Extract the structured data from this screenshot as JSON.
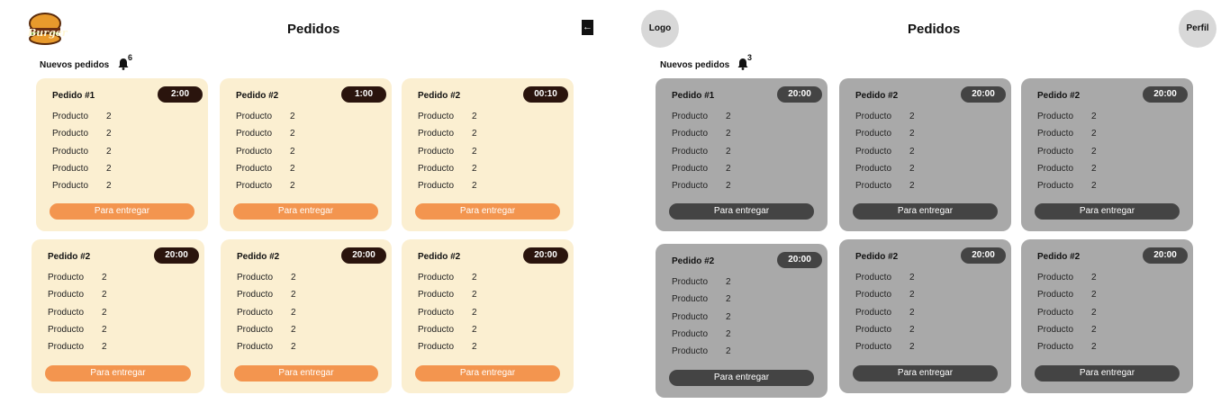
{
  "left": {
    "title": "Pedidos",
    "logo_text": "Burger",
    "subheading": "Nuevos pedidos",
    "notif_count": "6",
    "orders": [
      {
        "name": "Pedido #1",
        "time": "2:00",
        "items": [
          {
            "label": "Producto",
            "qty": "2"
          },
          {
            "label": "Producto",
            "qty": "2"
          },
          {
            "label": "Producto",
            "qty": "2"
          },
          {
            "label": "Producto",
            "qty": "2"
          },
          {
            "label": "Producto",
            "qty": "2"
          }
        ],
        "button": "Para entregar"
      },
      {
        "name": "Pedido #2",
        "time": "1:00",
        "items": [
          {
            "label": "Producto",
            "qty": "2"
          },
          {
            "label": "Producto",
            "qty": "2"
          },
          {
            "label": "Producto",
            "qty": "2"
          },
          {
            "label": "Producto",
            "qty": "2"
          },
          {
            "label": "Producto",
            "qty": "2"
          }
        ],
        "button": "Para entregar"
      },
      {
        "name": "Pedido #2",
        "time": "00:10",
        "items": [
          {
            "label": "Producto",
            "qty": "2"
          },
          {
            "label": "Producto",
            "qty": "2"
          },
          {
            "label": "Producto",
            "qty": "2"
          },
          {
            "label": "Producto",
            "qty": "2"
          },
          {
            "label": "Producto",
            "qty": "2"
          }
        ],
        "button": "Para entregar"
      },
      {
        "name": "Pedido #2",
        "time": "20:00",
        "items": [
          {
            "label": "Producto",
            "qty": "2"
          },
          {
            "label": "Producto",
            "qty": "2"
          },
          {
            "label": "Producto",
            "qty": "2"
          },
          {
            "label": "Producto",
            "qty": "2"
          },
          {
            "label": "Producto",
            "qty": "2"
          }
        ],
        "button": "Para entregar"
      },
      {
        "name": "Pedido #2",
        "time": "20:00",
        "items": [
          {
            "label": "Producto",
            "qty": "2"
          },
          {
            "label": "Producto",
            "qty": "2"
          },
          {
            "label": "Producto",
            "qty": "2"
          },
          {
            "label": "Producto",
            "qty": "2"
          },
          {
            "label": "Producto",
            "qty": "2"
          }
        ],
        "button": "Para entregar"
      },
      {
        "name": "Pedido #2",
        "time": "20:00",
        "items": [
          {
            "label": "Producto",
            "qty": "2"
          },
          {
            "label": "Producto",
            "qty": "2"
          },
          {
            "label": "Producto",
            "qty": "2"
          },
          {
            "label": "Producto",
            "qty": "2"
          },
          {
            "label": "Producto",
            "qty": "2"
          }
        ],
        "button": "Para entregar"
      }
    ]
  },
  "back_icon": "arrow-left-icon",
  "right": {
    "logo_label": "Logo",
    "title": "Pedidos",
    "profile_label": "Perfil",
    "subheading": "Nuevos pedidos",
    "notif_count": "3",
    "orders": [
      {
        "name": "Pedido #1",
        "time": "20:00",
        "items": [
          {
            "label": "Producto",
            "qty": "2"
          },
          {
            "label": "Producto",
            "qty": "2"
          },
          {
            "label": "Producto",
            "qty": "2"
          },
          {
            "label": "Producto",
            "qty": "2"
          },
          {
            "label": "Producto",
            "qty": "2"
          }
        ],
        "button": "Para entregar"
      },
      {
        "name": "Pedido #2",
        "time": "20:00",
        "items": [
          {
            "label": "Producto",
            "qty": "2"
          },
          {
            "label": "Producto",
            "qty": "2"
          },
          {
            "label": "Producto",
            "qty": "2"
          },
          {
            "label": "Producto",
            "qty": "2"
          },
          {
            "label": "Producto",
            "qty": "2"
          }
        ],
        "button": "Para entregar"
      },
      {
        "name": "Pedido #2",
        "time": "20:00",
        "items": [
          {
            "label": "Producto",
            "qty": "2"
          },
          {
            "label": "Producto",
            "qty": "2"
          },
          {
            "label": "Producto",
            "qty": "2"
          },
          {
            "label": "Producto",
            "qty": "2"
          },
          {
            "label": "Producto",
            "qty": "2"
          }
        ],
        "button": "Para entregar"
      },
      {
        "name": "Pedido #2",
        "time": "20:00",
        "items": [
          {
            "label": "Producto",
            "qty": "2"
          },
          {
            "label": "Producto",
            "qty": "2"
          },
          {
            "label": "Producto",
            "qty": "2"
          },
          {
            "label": "Producto",
            "qty": "2"
          },
          {
            "label": "Producto",
            "qty": "2"
          }
        ],
        "button": "Para entregar"
      },
      {
        "name": "Pedido #2",
        "time": "20:00",
        "items": [
          {
            "label": "Producto",
            "qty": "2"
          },
          {
            "label": "Producto",
            "qty": "2"
          },
          {
            "label": "Producto",
            "qty": "2"
          },
          {
            "label": "Producto",
            "qty": "2"
          },
          {
            "label": "Producto",
            "qty": "2"
          }
        ],
        "button": "Para entregar"
      },
      {
        "name": "Pedido #2",
        "time": "20:00",
        "items": [
          {
            "label": "Producto",
            "qty": "2"
          },
          {
            "label": "Producto",
            "qty": "2"
          },
          {
            "label": "Producto",
            "qty": "2"
          },
          {
            "label": "Producto",
            "qty": "2"
          },
          {
            "label": "Producto",
            "qty": "2"
          }
        ],
        "button": "Para entregar"
      }
    ]
  },
  "colors": {
    "cream": "#fbefd1",
    "orange": "#f3954f",
    "dark_brown": "#2a140d",
    "gray_card": "#a9a9a9",
    "dark_gray": "#444444"
  }
}
